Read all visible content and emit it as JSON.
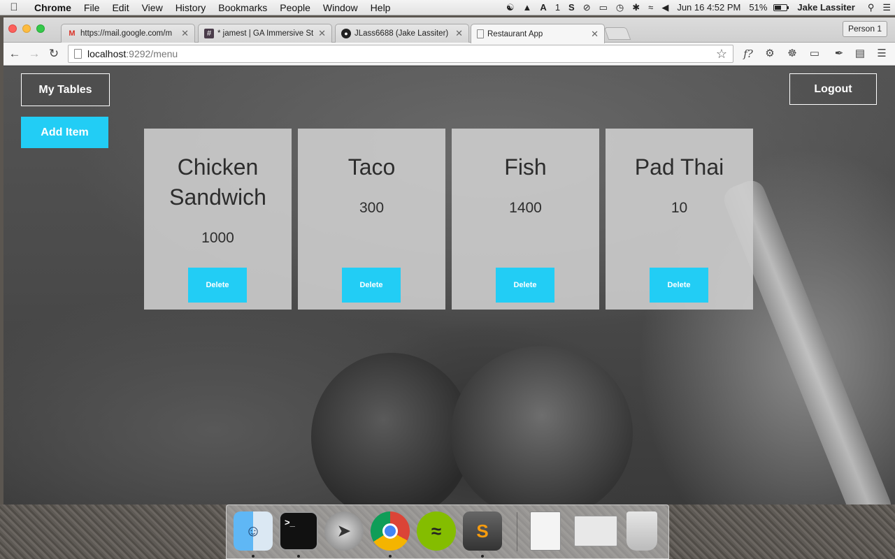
{
  "menubar": {
    "app_name": "Chrome",
    "menus": [
      "File",
      "Edit",
      "View",
      "History",
      "Bookmarks",
      "People",
      "Window",
      "Help"
    ],
    "status_a1": "1",
    "datetime": "Jun 16  4:52 PM",
    "battery": "51%",
    "user": "Jake Lassiter"
  },
  "browser": {
    "tabs": [
      {
        "title": "https://mail.google.com/m",
        "icon": "gmail-icon"
      },
      {
        "title": "* jamest | GA Immersive St",
        "icon": "slack-icon"
      },
      {
        "title": "JLass6688 (Jake Lassiter)",
        "icon": "github-icon"
      },
      {
        "title": "Restaurant App",
        "icon": "page-icon",
        "active": true
      }
    ],
    "person": "Person 1",
    "url_host": "localhost",
    "url_path": ":9292/menu",
    "ext_fx": "f?"
  },
  "app": {
    "my_tables_label": "My Tables",
    "add_item_label": "Add Item",
    "logout_label": "Logout",
    "delete_label": "Delete",
    "accent_color": "#22cdf5",
    "items": [
      {
        "name": "Chicken Sandwich",
        "price": "1000"
      },
      {
        "name": "Taco",
        "price": "300"
      },
      {
        "name": "Fish",
        "price": "1400"
      },
      {
        "name": "Pad Thai",
        "price": "10"
      }
    ]
  },
  "dock": {
    "apps": [
      "finder-icon",
      "terminal-icon",
      "launchpad-icon",
      "chrome-icon",
      "spotify-icon",
      "sublime-text-icon",
      "document-icon",
      "screenshot-icon",
      "trash-icon"
    ]
  }
}
